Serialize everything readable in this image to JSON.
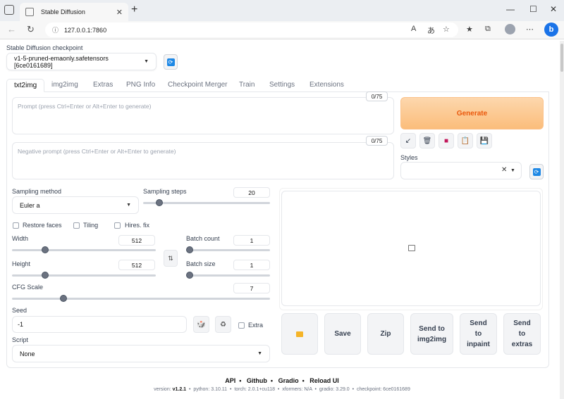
{
  "browser": {
    "tab_title": "Stable Diffusion",
    "url": "127.0.0.1:7860"
  },
  "checkpoint": {
    "label": "Stable Diffusion checkpoint",
    "value": "v1-5-pruned-emaonly.safetensors [6ce0161689]"
  },
  "tabs": [
    "txt2img",
    "img2img",
    "Extras",
    "PNG Info",
    "Checkpoint Merger",
    "Train",
    "Settings",
    "Extensions"
  ],
  "prompt": {
    "placeholder": "Prompt (press Ctrl+Enter or Alt+Enter to generate)",
    "tokens": "0/75"
  },
  "negative_prompt": {
    "placeholder": "Negative prompt (press Ctrl+Enter or Alt+Enter to generate)",
    "tokens": "0/75"
  },
  "generate_label": "Generate",
  "styles_label": "Styles",
  "sampling_method": {
    "label": "Sampling method",
    "value": "Euler a"
  },
  "sampling_steps": {
    "label": "Sampling steps",
    "value": "20",
    "fraction": 0.13
  },
  "checkboxes": {
    "restore_faces": "Restore faces",
    "tiling": "Tiling",
    "hires_fix": "Hires. fix"
  },
  "width": {
    "label": "Width",
    "value": "512",
    "fraction": 0.23
  },
  "height": {
    "label": "Height",
    "value": "512",
    "fraction": 0.23
  },
  "batch_count": {
    "label": "Batch count",
    "value": "1",
    "fraction": 0.0
  },
  "batch_size": {
    "label": "Batch size",
    "value": "1",
    "fraction": 0.0
  },
  "cfg_scale": {
    "label": "CFG Scale",
    "value": "7",
    "fraction": 0.2
  },
  "seed": {
    "label": "Seed",
    "value": "-1",
    "extra_label": "Extra"
  },
  "script": {
    "label": "Script",
    "value": "None"
  },
  "output_buttons": {
    "save": "Save",
    "zip": "Zip",
    "send_img2img": [
      "Send to",
      "img2img"
    ],
    "send_inpaint": [
      "Send",
      "to",
      "inpaint"
    ],
    "send_extras": [
      "Send",
      "to",
      "extras"
    ]
  },
  "footer": {
    "links": [
      "API",
      "Github",
      "Gradio",
      "Reload UI"
    ],
    "info": [
      {
        "k": "version: ",
        "v": "v1.2.1"
      },
      {
        "k": "python: ",
        "v": "3.10.11"
      },
      {
        "k": "torch: ",
        "v": "2.0.1+cu118"
      },
      {
        "k": "xformers: ",
        "v": "N/A"
      },
      {
        "k": "gradio: ",
        "v": "3.29.0"
      },
      {
        "k": "checkpoint: ",
        "v": "6ce0161689"
      }
    ]
  },
  "colors": {
    "accent": "#ea580c",
    "generate_bg": "#fbbd7b",
    "refresh_icon": "#1e88e5"
  }
}
